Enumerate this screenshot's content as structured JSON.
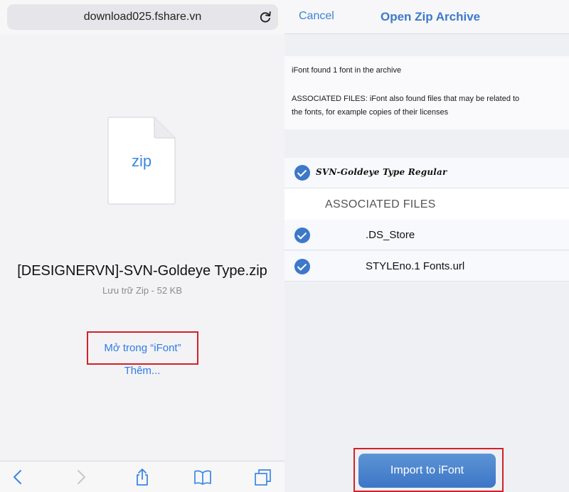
{
  "left_panel": {
    "url": "download025.fshare.vn",
    "file": {
      "ext": "zip",
      "name": "[DESIGNERVN]-SVN-Goldeye Type.zip",
      "meta": "Lưu trữ Zip - 52 KB"
    },
    "open_in_label": "Mở trong “iFont”",
    "more_label": "Thêm...",
    "toolbar": [
      "back-icon",
      "forward-icon",
      "share-icon",
      "bookmarks-icon",
      "tabs-icon"
    ]
  },
  "right_panel": {
    "cancel_label": "Cancel",
    "title": "Open Zip Archive",
    "info": {
      "line1": "iFont found 1 font in the archive",
      "line2": "ASSOCIATED FILES: iFont also found files that may be related to",
      "line3": "the fonts, for example copies of their licenses"
    },
    "font_item": {
      "name": "SVN-Goldeye Type Regular",
      "checked": true
    },
    "associated_header": "ASSOCIATED FILES",
    "associated_files": [
      {
        "name": ".DS_Store",
        "checked": true
      },
      {
        "name": "STYLEno.1 Fonts.url",
        "checked": true
      }
    ],
    "import_label": "Import to iFont"
  },
  "colors": {
    "accent": "#3c82d6",
    "check": "#3d78c9",
    "highlight": "#d42027"
  }
}
